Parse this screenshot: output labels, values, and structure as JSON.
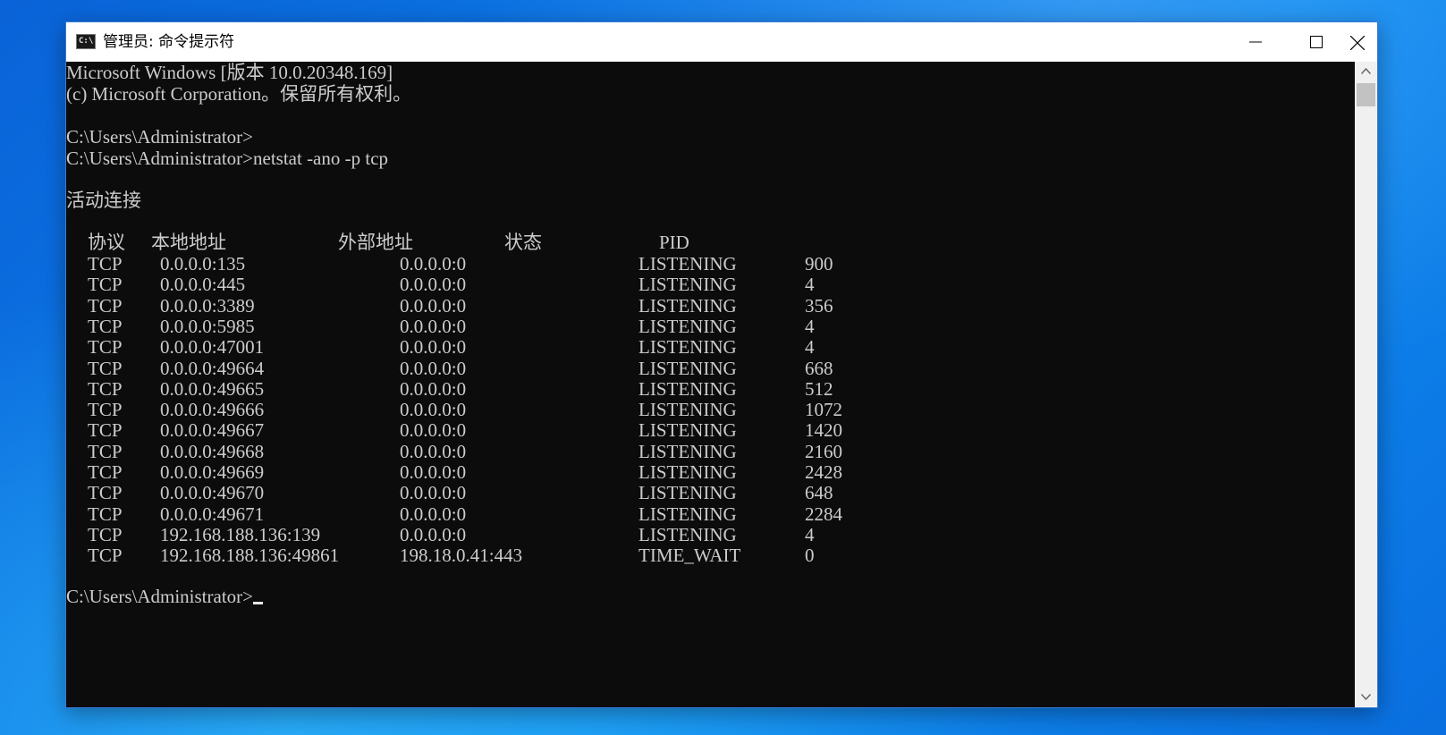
{
  "window": {
    "title": "管理员: 命令提示符",
    "icon_label": "C:\\",
    "controls": [
      "minimize-icon",
      "maximize-icon",
      "close-icon"
    ]
  },
  "console": {
    "banner": [
      "Microsoft Windows [版本 10.0.20348.169]",
      "(c) Microsoft Corporation。保留所有权利。"
    ],
    "prompt_1": "C:\\Users\\Administrator>",
    "prompt_2": "C:\\Users\\Administrator>netstat -ano -p tcp",
    "section_title": "活动连接",
    "headers": {
      "proto": "协议",
      "local": "本地地址",
      "foreign": "外部地址",
      "state": "状态",
      "pid": "PID"
    },
    "rows": [
      {
        "proto": "TCP",
        "local": "0.0.0.0:135",
        "foreign": "0.0.0.0:0",
        "state": "LISTENING",
        "pid": "900"
      },
      {
        "proto": "TCP",
        "local": "0.0.0.0:445",
        "foreign": "0.0.0.0:0",
        "state": "LISTENING",
        "pid": "4"
      },
      {
        "proto": "TCP",
        "local": "0.0.0.0:3389",
        "foreign": "0.0.0.0:0",
        "state": "LISTENING",
        "pid": "356"
      },
      {
        "proto": "TCP",
        "local": "0.0.0.0:5985",
        "foreign": "0.0.0.0:0",
        "state": "LISTENING",
        "pid": "4"
      },
      {
        "proto": "TCP",
        "local": "0.0.0.0:47001",
        "foreign": "0.0.0.0:0",
        "state": "LISTENING",
        "pid": "4"
      },
      {
        "proto": "TCP",
        "local": "0.0.0.0:49664",
        "foreign": "0.0.0.0:0",
        "state": "LISTENING",
        "pid": "668"
      },
      {
        "proto": "TCP",
        "local": "0.0.0.0:49665",
        "foreign": "0.0.0.0:0",
        "state": "LISTENING",
        "pid": "512"
      },
      {
        "proto": "TCP",
        "local": "0.0.0.0:49666",
        "foreign": "0.0.0.0:0",
        "state": "LISTENING",
        "pid": "1072"
      },
      {
        "proto": "TCP",
        "local": "0.0.0.0:49667",
        "foreign": "0.0.0.0:0",
        "state": "LISTENING",
        "pid": "1420"
      },
      {
        "proto": "TCP",
        "local": "0.0.0.0:49668",
        "foreign": "0.0.0.0:0",
        "state": "LISTENING",
        "pid": "2160"
      },
      {
        "proto": "TCP",
        "local": "0.0.0.0:49669",
        "foreign": "0.0.0.0:0",
        "state": "LISTENING",
        "pid": "2428"
      },
      {
        "proto": "TCP",
        "local": "0.0.0.0:49670",
        "foreign": "0.0.0.0:0",
        "state": "LISTENING",
        "pid": "648"
      },
      {
        "proto": "TCP",
        "local": "0.0.0.0:49671",
        "foreign": "0.0.0.0:0",
        "state": "LISTENING",
        "pid": "2284"
      },
      {
        "proto": "TCP",
        "local": "192.168.188.136:139",
        "foreign": "0.0.0.0:0",
        "state": "LISTENING",
        "pid": "4"
      },
      {
        "proto": "TCP",
        "local": "192.168.188.136:49861",
        "foreign": "198.18.0.41:443",
        "state": "TIME_WAIT",
        "pid": "0"
      }
    ],
    "final_prompt": "C:\\Users\\Administrator>"
  },
  "colors": {
    "console_bg": "#0c0c0c",
    "console_text": "#cccccc",
    "titlebar_bg": "#ffffff",
    "desktop_accent": "#0b78e6"
  }
}
